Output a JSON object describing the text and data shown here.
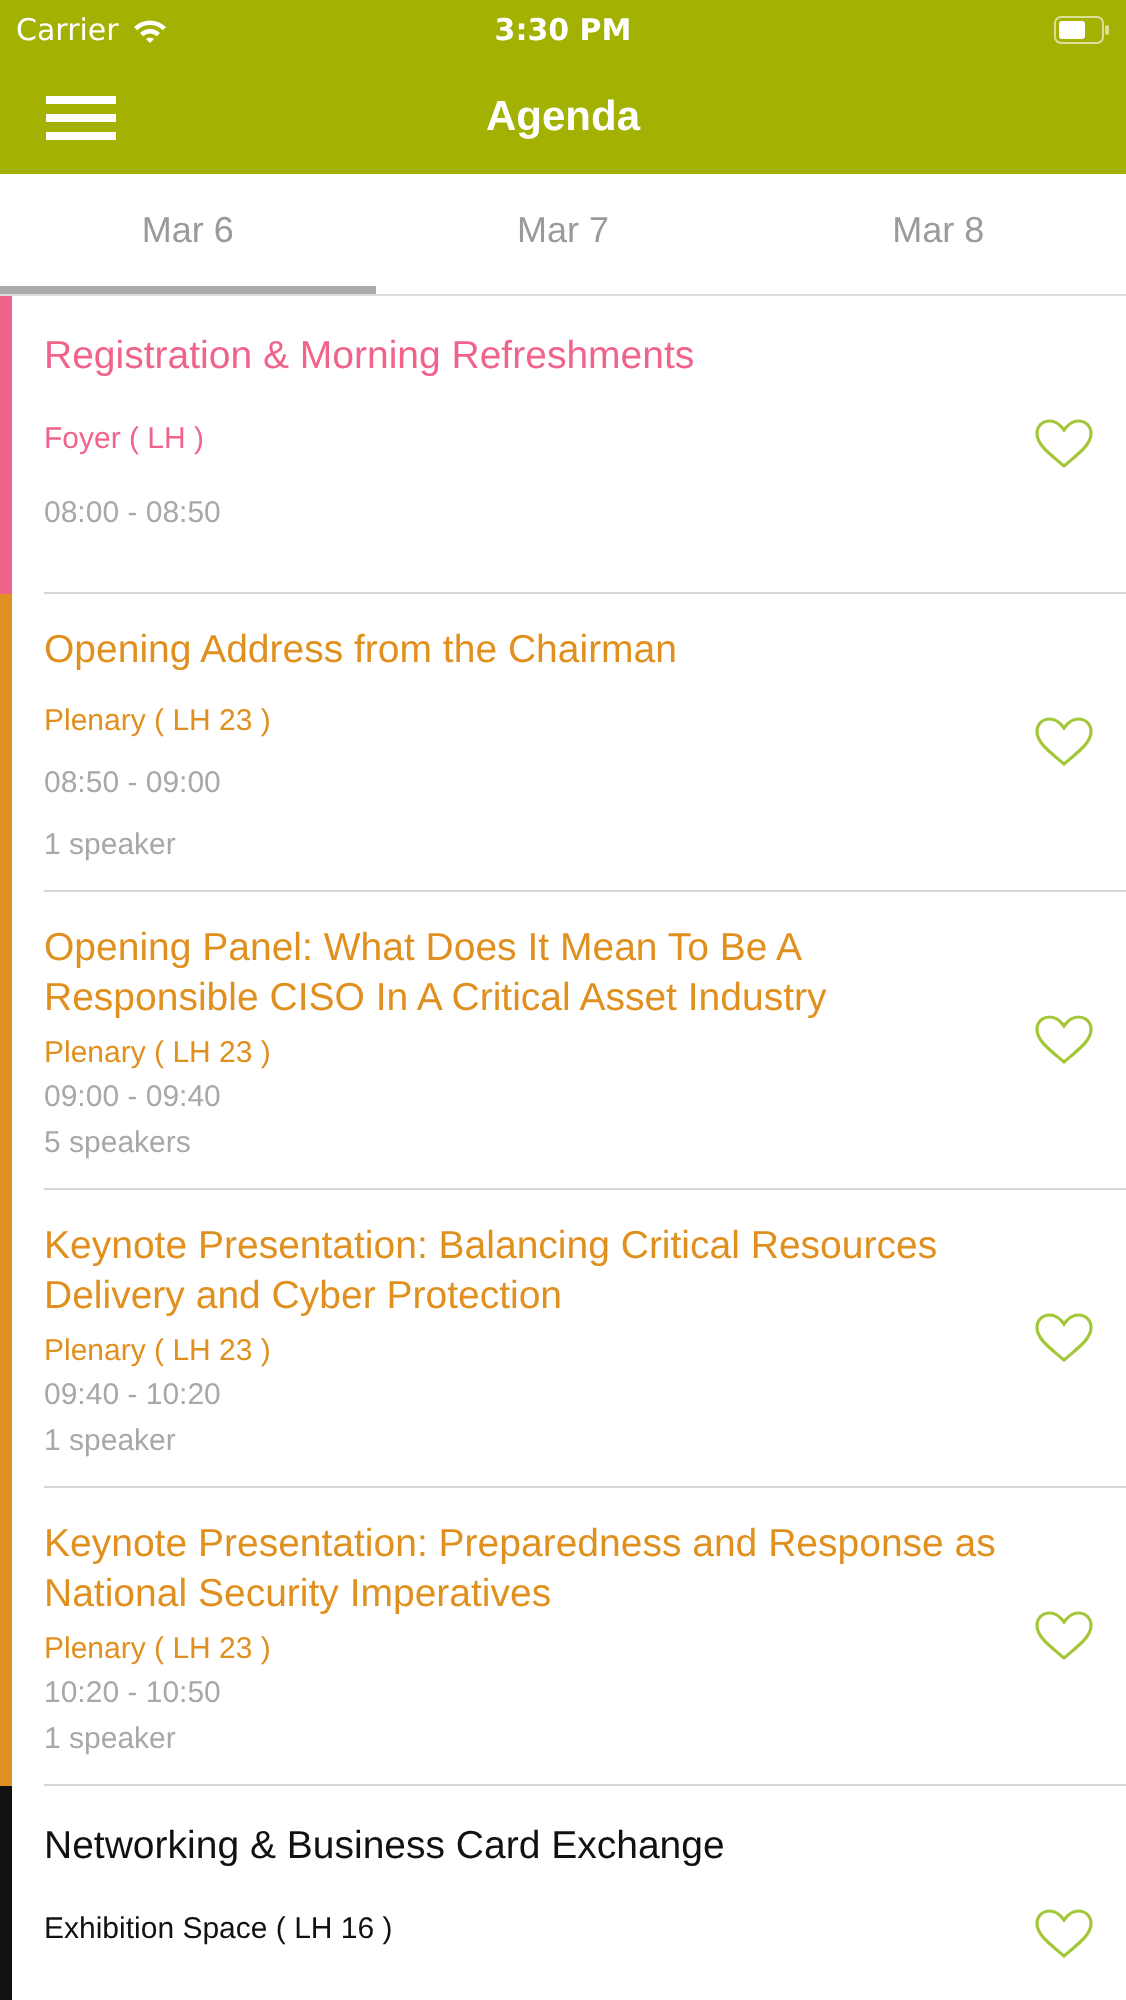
{
  "status_bar": {
    "carrier": "Carrier",
    "time": "3:30 PM"
  },
  "nav_bar": {
    "title": "Agenda"
  },
  "tabs": [
    {
      "label": "Mar 6",
      "selected": true
    },
    {
      "label": "Mar 7",
      "selected": false
    },
    {
      "label": "Mar 8",
      "selected": false
    }
  ],
  "sessions": [
    {
      "title": "Registration & Morning Refreshments",
      "location": "Foyer ( LH )",
      "time": "08:00 - 08:50",
      "color": "#f0648c",
      "favorite": false
    },
    {
      "title": "Opening Address from the Chairman",
      "location": "Plenary ( LH 23 )",
      "time": "08:50 - 09:00",
      "speakers": "1 speaker",
      "color": "#e0901e",
      "favorite": false
    },
    {
      "title": "Opening Panel: What Does It Mean To Be A Responsible CISO In A Critical Asset Industry",
      "location": "Plenary ( LH 23 )",
      "time": "09:00 - 09:40",
      "speakers": "5 speakers",
      "color": "#e0901e",
      "favorite": false
    },
    {
      "title": "Keynote Presentation: Balancing Critical Resources Delivery and Cyber Protection",
      "location": "Plenary ( LH 23 )",
      "time": "09:40 - 10:20",
      "speakers": "1 speaker",
      "color": "#e0901e",
      "favorite": false
    },
    {
      "title": "Keynote Presentation: Preparedness and Response as National Security Imperatives",
      "location": "Plenary ( LH 23 )",
      "time": "10:20 - 10:50",
      "speakers": "1 speaker",
      "color": "#e0901e",
      "favorite": false
    },
    {
      "title": "Networking & Business Card Exchange",
      "location": "Exhibition Space ( LH 16 )",
      "color": "#111111",
      "favorite": false
    }
  ]
}
